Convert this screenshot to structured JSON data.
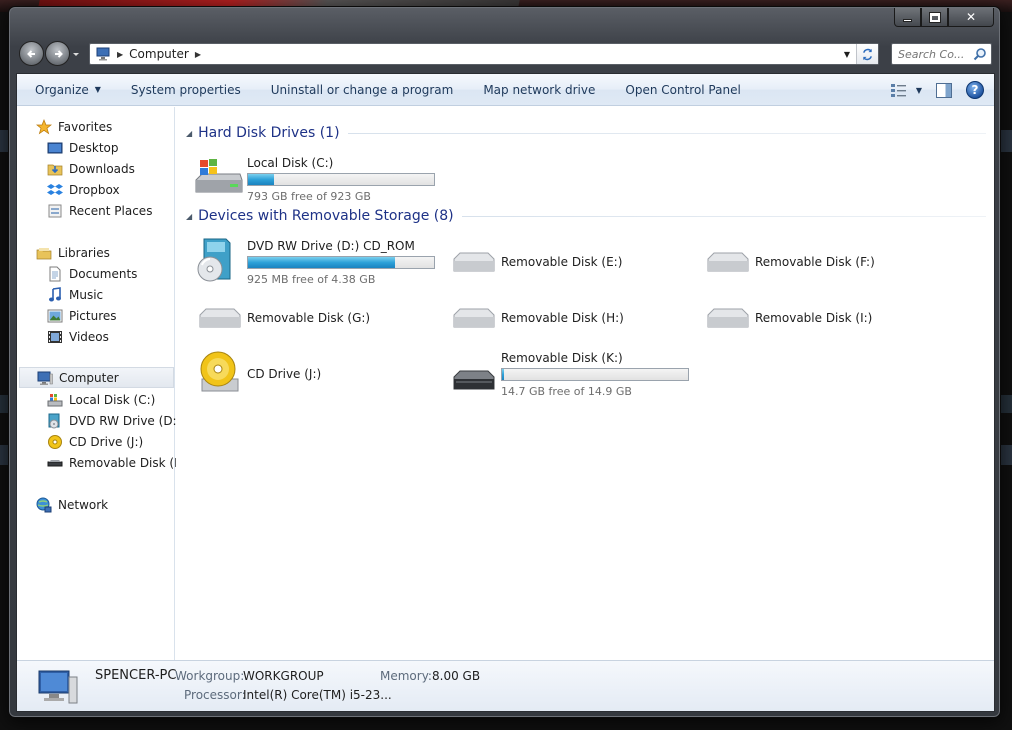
{
  "window": {
    "address_crumb": "Computer",
    "search_placeholder": "Search Co..."
  },
  "toolbar": {
    "organize": "Organize",
    "system_properties": "System properties",
    "uninstall": "Uninstall or change a program",
    "map_drive": "Map network drive",
    "control_panel": "Open Control Panel"
  },
  "sidebar": {
    "favorites": "Favorites",
    "desktop": "Desktop",
    "downloads": "Downloads",
    "dropbox": "Dropbox",
    "recent": "Recent Places",
    "libraries": "Libraries",
    "documents": "Documents",
    "music": "Music",
    "pictures": "Pictures",
    "videos": "Videos",
    "computer": "Computer",
    "local_disk": "Local Disk (C:)",
    "dvd": "DVD RW Drive (D:) C",
    "cd": "CD Drive (J:)",
    "removable_k": "Removable Disk (K:)",
    "network": "Network"
  },
  "groups": {
    "hdd": "Hard Disk Drives (1)",
    "removable": "Devices with Removable Storage (8)"
  },
  "drives": {
    "c": {
      "name": "Local Disk (C:)",
      "free": "793 GB free of 923 GB",
      "used_fraction": 0.14
    },
    "d": {
      "name": "DVD RW Drive (D:) CD_ROM",
      "free": "925 MB free of 4.38 GB",
      "used_fraction": 0.79
    },
    "e": {
      "name": "Removable Disk (E:)"
    },
    "f": {
      "name": "Removable Disk (F:)"
    },
    "g": {
      "name": "Removable Disk (G:)"
    },
    "h": {
      "name": "Removable Disk (H:)"
    },
    "i": {
      "name": "Removable Disk (I:)"
    },
    "j": {
      "name": "CD Drive (J:)"
    },
    "k": {
      "name": "Removable Disk (K:)",
      "free": "14.7 GB free of 14.9 GB",
      "used_fraction": 0.01
    }
  },
  "details": {
    "pc_name": "SPENCER-PC",
    "workgroup_label": "Workgroup:",
    "workgroup": "WORKGROUP",
    "memory_label": "Memory:",
    "memory": "8.00 GB",
    "processor_label": "Processor:",
    "processor": "Intel(R) Core(TM) i5-23..."
  }
}
